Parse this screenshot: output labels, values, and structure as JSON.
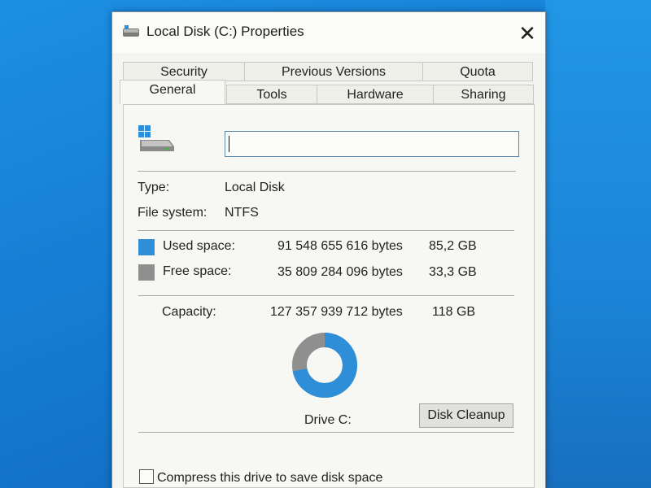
{
  "window": {
    "title": "Local Disk (C:) Properties",
    "close_glyph": "✕"
  },
  "tabs": {
    "row1": [
      "Security",
      "Previous Versions",
      "Quota"
    ],
    "row2": [
      "General",
      "Tools",
      "Hardware",
      "Sharing"
    ],
    "active": "General"
  },
  "general": {
    "drive_name_value": "",
    "type_label": "Type:",
    "type_value": "Local Disk",
    "fs_label": "File system:",
    "fs_value": "NTFS",
    "used": {
      "label": "Used space:",
      "bytes": "91 548 655 616 bytes",
      "size": "85,2 GB",
      "color": "#2e8fd8"
    },
    "free": {
      "label": "Free space:",
      "bytes": "35 809 284 096 bytes",
      "size": "33,3 GB",
      "color": "#8f8f8f"
    },
    "capacity": {
      "label": "Capacity:",
      "bytes": "127 357 939 712 bytes",
      "size": "118 GB"
    },
    "drive_label": "Drive C:",
    "cleanup_button": "Disk Cleanup",
    "compress_label": "Compress this drive to save disk space",
    "used_fraction": 0.719
  },
  "icons": {
    "title_icon": "drive-icon",
    "drive_icon": "windows-drive-icon"
  }
}
